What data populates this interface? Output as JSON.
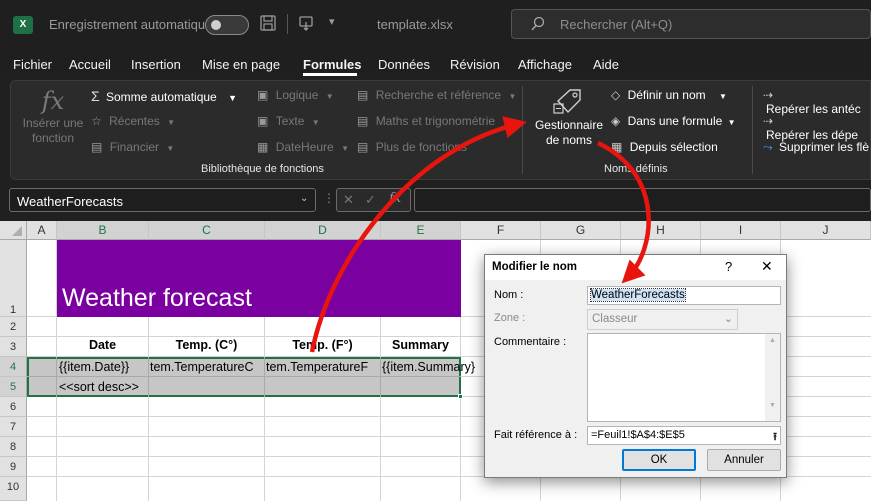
{
  "titlebar": {
    "autosave_label": "Enregistrement automatique",
    "filename": "template.xlsx",
    "search_placeholder": "Rechercher (Alt+Q)",
    "logo_letter": "X"
  },
  "menu": {
    "items": [
      "Fichier",
      "Accueil",
      "Insertion",
      "Mise en page",
      "Formules",
      "Données",
      "Révision",
      "Affichage",
      "Aide"
    ],
    "active": "Formules"
  },
  "ribbon": {
    "insert_function": "Insérer une fonction",
    "insert_function_line1": "Insérer une",
    "insert_function_line2": "fonction",
    "autosum": "Somme automatique",
    "recent": "Récentes",
    "financial": "Financier",
    "logical": "Logique",
    "text": "Texte",
    "datetime": "DateHeure",
    "lookup": "Recherche et référence",
    "math": "Maths et trigonométrie",
    "more": "Plus de fonctions",
    "library_label": "Bibliothèque de fonctions",
    "name_manager_line1": "Gestionnaire",
    "name_manager_line2": "de noms",
    "define_name": "Définir un nom",
    "in_formula": "Dans une formule",
    "from_selection": "Depuis sélection",
    "defined_names_label": "Noms définis",
    "trace_precedents": "Repérer les antéc",
    "trace_dependents": "Repérer les dépe",
    "remove_arrows": "Supprimer les flè"
  },
  "formula_bar": {
    "name_box": "WeatherForecasts",
    "fx": "fx"
  },
  "sheet": {
    "columns": [
      "A",
      "B",
      "C",
      "D",
      "E",
      "F",
      "G",
      "H",
      "I",
      "J"
    ],
    "rows": [
      "1",
      "2",
      "3",
      "4",
      "5",
      "6",
      "7",
      "8",
      "9",
      "10"
    ],
    "banner_title": "Weather forecast",
    "headers": {
      "date": "Date",
      "temp_c": "Temp. (C°)",
      "temp_f": "Temp. (F°)",
      "summary": "Summary"
    },
    "row4": {
      "b": "{{item.Date}}",
      "c": "tem.TemperatureC",
      "d": "tem.TemperatureF",
      "e": "{{item.Summary}"
    },
    "row5": {
      "b": "<<sort desc>>"
    }
  },
  "dialog": {
    "title": "Modifier le nom",
    "help": "?",
    "close": "✕",
    "name_label": "Nom :",
    "name_value": "WeatherForecasts",
    "scope_label": "Zone :",
    "scope_value": "Classeur",
    "comment_label": "Commentaire :",
    "refers_label": "Fait référence à :",
    "refers_value": "=Feuil1!$A$4:$E$5",
    "ok": "OK",
    "cancel": "Annuler"
  },
  "colors": {
    "banner": "#7b00a0",
    "excel_green": "#1e7145",
    "annotation_arrow": "#e8140e"
  }
}
